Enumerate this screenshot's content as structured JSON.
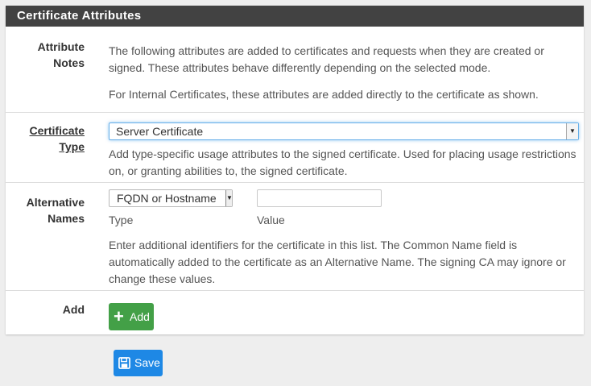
{
  "panel": {
    "title": "Certificate Attributes"
  },
  "attribute_notes": {
    "label_line1": "Attribute",
    "label_line2": "Notes",
    "text1": "The following attributes are added to certificates and requests when they are created or signed. These attributes behave differently depending on the selected mode.",
    "text2": "For Internal Certificates, these attributes are added directly to the certificate as shown."
  },
  "certificate_type": {
    "label_line1": "Certificate",
    "label_line2": "Type",
    "selected": "Server Certificate",
    "help": "Add type-specific usage attributes to the signed certificate. Used for placing usage restrictions on, or granting abilities to, the signed certificate."
  },
  "alternative_names": {
    "label_line1": "Alternative",
    "label_line2": "Names",
    "type_selected": "FQDN or Hostname",
    "value": "",
    "type_label": "Type",
    "value_label": "Value",
    "help": "Enter additional identifiers for the certificate in this list. The Common Name field is automatically added to the certificate as an Alternative Name. The signing CA may ignore or change these values."
  },
  "add": {
    "label": "Add",
    "button_label": "Add",
    "icon": "plus-icon"
  },
  "save": {
    "button_label": "Save",
    "icon": "floppy-disk-icon"
  },
  "colors": {
    "header_bg": "#424242",
    "add_button": "#43a047",
    "save_button": "#1e88e5",
    "focus_border": "#66afe9"
  }
}
